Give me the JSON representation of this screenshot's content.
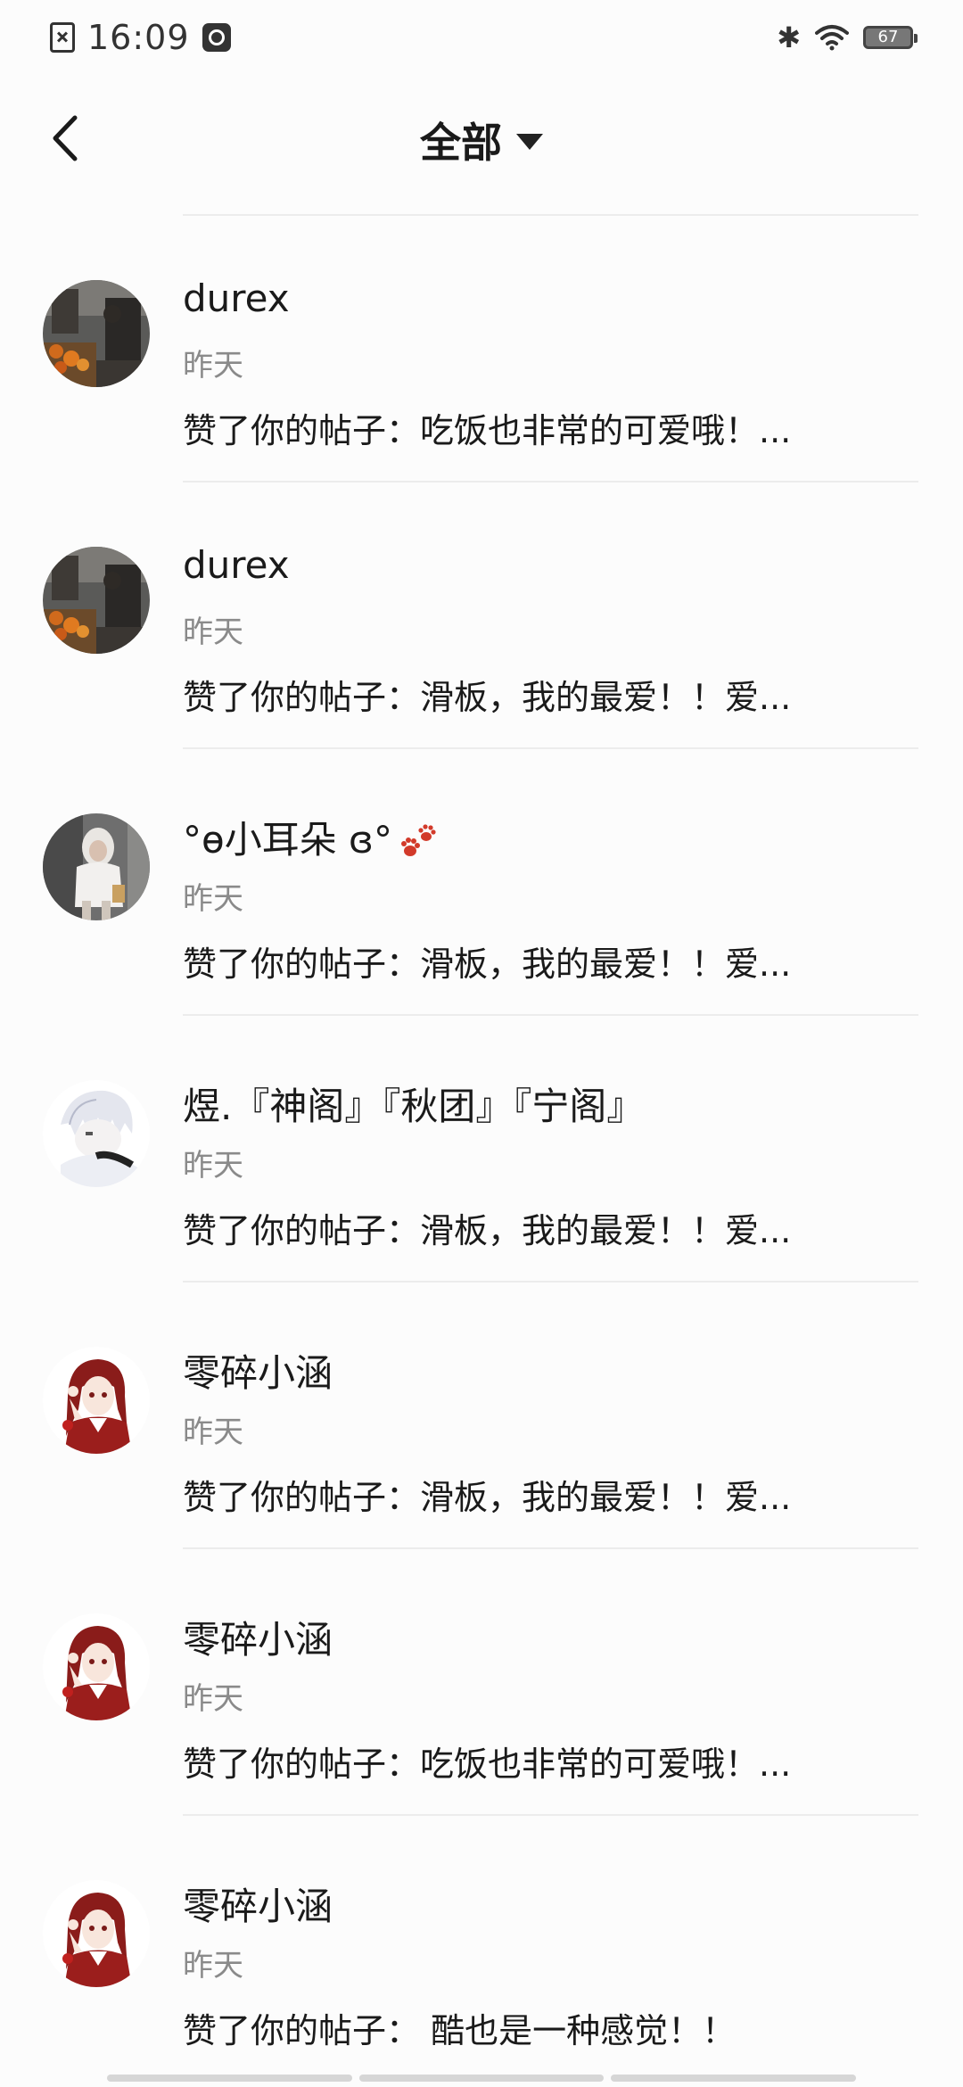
{
  "status_bar": {
    "time": "16:09",
    "battery": "67",
    "bluetooth_glyph": "✱"
  },
  "header": {
    "title": "全部"
  },
  "items": [
    {
      "name": "durex",
      "time": "昨天",
      "content": "赞了你的帖子：吃饭也非常的可爱哦！...",
      "avatar": "photo-street"
    },
    {
      "name": "durex",
      "time": "昨天",
      "content": "赞了你的帖子：滑板，我的最爱！！爱...",
      "avatar": "photo-street"
    },
    {
      "name": "°ɵ小耳朵 ɞ°",
      "time": "昨天",
      "content": "赞了你的帖子：滑板，我的最爱！！爱...",
      "avatar": "photo-girl",
      "emoji": "paw-prints-icon"
    },
    {
      "name": "煜.『神阁』『秋团』『宁阁』",
      "time": "昨天",
      "content": "赞了你的帖子：滑板，我的最爱！！爱...",
      "avatar": "anime-white-hair"
    },
    {
      "name": "零碎小涵",
      "time": "昨天",
      "content": "赞了你的帖子：滑板，我的最爱！！爱...",
      "avatar": "anime-red-girl"
    },
    {
      "name": "零碎小涵",
      "time": "昨天",
      "content": "赞了你的帖子：吃饭也非常的可爱哦！...",
      "avatar": "anime-red-girl"
    },
    {
      "name": "零碎小涵",
      "time": "昨天",
      "content": "赞了你的帖子： 酷也是一种感觉！！",
      "avatar": "anime-red-girl"
    }
  ],
  "colors": {
    "background": "#fcfcfc",
    "text": "#1a1a1a",
    "secondary_text": "#8a8a8a",
    "divider": "#ececec"
  }
}
